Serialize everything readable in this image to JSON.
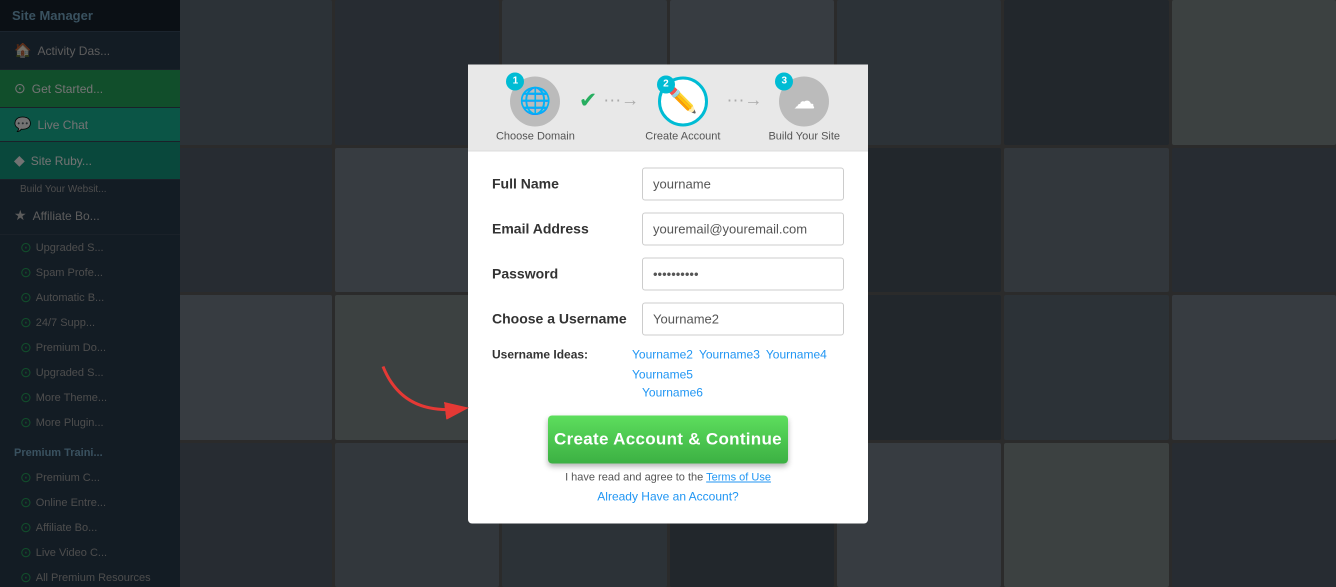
{
  "sidebar": {
    "header": "Site Manager",
    "items": [
      {
        "id": "activity",
        "label": "Activity Das...",
        "icon": "🏠"
      },
      {
        "id": "get-started",
        "label": "Get Started...",
        "icon": "⊙",
        "style": "green"
      },
      {
        "id": "live-chat",
        "label": "Live Chat",
        "icon": "💬",
        "style": "teal"
      },
      {
        "id": "site-ruby",
        "label": "Site Ruby...",
        "icon": "◆",
        "style": "blue-teal",
        "sub": "Build Your Websit..."
      }
    ],
    "sub_items": [
      {
        "id": "upgraded-s",
        "label": "Upgraded S..."
      },
      {
        "id": "spam-profe",
        "label": "Spam Profe..."
      },
      {
        "id": "automatic-b",
        "label": "Automatic B..."
      },
      {
        "id": "247-supp",
        "label": "24/7 Supp..."
      },
      {
        "id": "premium-do",
        "label": "Premium Do..."
      },
      {
        "id": "upgraded-s2",
        "label": "Upgraded S..."
      },
      {
        "id": "more-theme",
        "label": "More Theme..."
      },
      {
        "id": "more-plugin",
        "label": "More Plugin..."
      }
    ],
    "section_label": "Premium Traini...",
    "training_items": [
      {
        "id": "premium-c",
        "label": "Premium C..."
      },
      {
        "id": "online-entr",
        "label": "Online Entre..."
      },
      {
        "id": "affiliate-bo",
        "label": "Affiliate Bo..."
      },
      {
        "id": "live-video-c",
        "label": "Live Video C..."
      },
      {
        "id": "all-premium",
        "label": "All Premium Resources"
      }
    ],
    "affiliate_label": "★ Affiliate Bo..."
  },
  "steps": [
    {
      "id": "choose-domain",
      "number": "1",
      "label": "Choose Domain",
      "icon": "🌐",
      "done": true
    },
    {
      "id": "create-account",
      "number": "2",
      "label": "Create Account",
      "icon": "✏️",
      "active": true
    },
    {
      "id": "build-site",
      "number": "3",
      "label": "Build Your Site",
      "icon": "☁",
      "done": false
    }
  ],
  "form": {
    "fields": [
      {
        "id": "full-name",
        "label": "Full Name",
        "value": "yourname",
        "placeholder": "yourname",
        "type": "text"
      },
      {
        "id": "email-address",
        "label": "Email Address",
        "value": "youremail@youremail.com",
        "placeholder": "youremail@youremail.com",
        "type": "email"
      },
      {
        "id": "password",
        "label": "Password",
        "value": "••••••••••",
        "placeholder": "",
        "type": "password"
      },
      {
        "id": "username",
        "label": "Choose a Username",
        "value": "Yourname2",
        "placeholder": "Yourname2",
        "type": "text"
      }
    ],
    "username_ideas_label": "Username Ideas:",
    "username_ideas": [
      "Yourname2",
      "Yourname3",
      "Yourname4",
      "Yourname5",
      "Yourname6"
    ]
  },
  "buttons": {
    "create": "Create Account & Continue",
    "terms_text": "I have read and agree to the",
    "terms_link": "Terms of Use",
    "already": "Already Have an Account?"
  }
}
